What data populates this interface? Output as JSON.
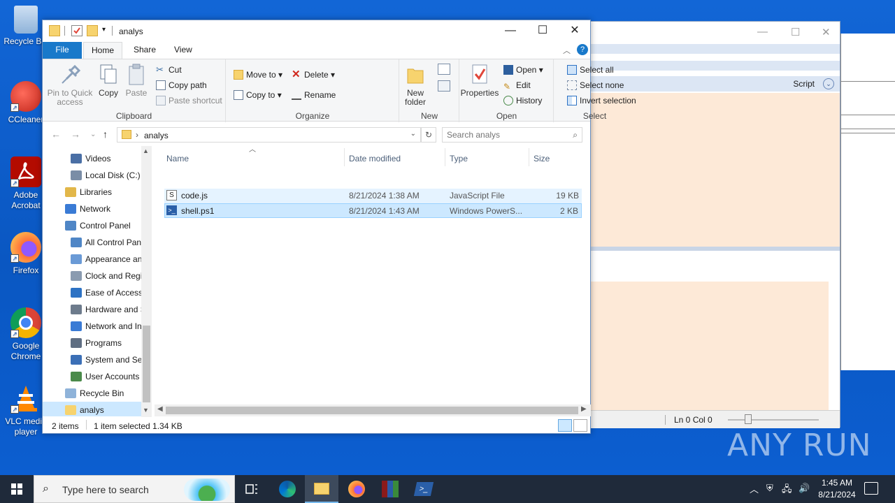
{
  "desktop": {
    "icons": [
      {
        "label": "Recycle Bin",
        "color": "#8fb3d9"
      },
      {
        "label": "CCleaner",
        "color": "#e23b2e"
      },
      {
        "label": "Adobe Acrobat",
        "color": "#b30b00"
      },
      {
        "label": "Firefox",
        "color": "#ff7139"
      },
      {
        "label": "Google Chrome",
        "color": "#4285f4"
      },
      {
        "label": "VLC media player",
        "color": "#ff8800"
      }
    ],
    "watermark": "ANY RUN"
  },
  "bg_window": {
    "script_label": "Script",
    "status_position": "Ln 0  Col 0"
  },
  "explorer": {
    "title": "analys",
    "ribbon_tabs": [
      "File",
      "Home",
      "Share",
      "View"
    ],
    "clipboard": {
      "pin_label": "Pin to Quick access",
      "copy_label": "Copy",
      "paste_label": "Paste",
      "cut_label": "Cut",
      "copy_path_label": "Copy path",
      "paste_shortcut_label": "Paste shortcut",
      "group_label": "Clipboard"
    },
    "organize": {
      "move_to_label": "Move to",
      "delete_label": "Delete",
      "copy_to_label": "Copy to",
      "rename_label": "Rename",
      "group_label": "Organize"
    },
    "new": {
      "new_folder_label": "New folder",
      "group_label": "New"
    },
    "open": {
      "properties_label": "Properties",
      "open_label": "Open",
      "edit_label": "Edit",
      "history_label": "History",
      "group_label": "Open"
    },
    "select": {
      "select_all_label": "Select all",
      "select_none_label": "Select none",
      "invert_label": "Invert selection",
      "group_label": "Select"
    },
    "address": {
      "crumb": "analys",
      "search_placeholder": "Search analys"
    },
    "nav_items": [
      {
        "label": "Videos",
        "indent": 1,
        "icon": "videos-icon",
        "color": "#4a6fa5"
      },
      {
        "label": "Local Disk (C:)",
        "indent": 1,
        "icon": "drive-icon",
        "color": "#7a8da6"
      },
      {
        "label": "Libraries",
        "indent": 0,
        "icon": "libraries-icon",
        "color": "#e2b74a"
      },
      {
        "label": "Network",
        "indent": 0,
        "icon": "network-icon",
        "color": "#3a7bd5"
      },
      {
        "label": "Control Panel",
        "indent": 0,
        "icon": "control-panel-icon",
        "color": "#4f86c6"
      },
      {
        "label": "All Control Panel Items",
        "indent": 1,
        "icon": "control-panel-icon",
        "color": "#4f86c6"
      },
      {
        "label": "Appearance and Personalization",
        "indent": 1,
        "icon": "appearance-icon",
        "color": "#6a9ad6"
      },
      {
        "label": "Clock and Region",
        "indent": 1,
        "icon": "clock-icon",
        "color": "#8a9bb0"
      },
      {
        "label": "Ease of Access",
        "indent": 1,
        "icon": "ease-of-access-icon",
        "color": "#2d72c4"
      },
      {
        "label": "Hardware and Sound",
        "indent": 1,
        "icon": "hardware-icon",
        "color": "#6d7b8c"
      },
      {
        "label": "Network and Internet",
        "indent": 1,
        "icon": "network-internet-icon",
        "color": "#3a7bd5"
      },
      {
        "label": "Programs",
        "indent": 1,
        "icon": "programs-icon",
        "color": "#5f6e82"
      },
      {
        "label": "System and Security",
        "indent": 1,
        "icon": "system-security-icon",
        "color": "#3b6fb6"
      },
      {
        "label": "User Accounts",
        "indent": 1,
        "icon": "user-accounts-icon",
        "color": "#4a8a4a"
      },
      {
        "label": "Recycle Bin",
        "indent": 0,
        "icon": "recycle-bin-icon",
        "color": "#8fb3d9"
      },
      {
        "label": "analys",
        "indent": 0,
        "icon": "folder-icon",
        "color": "#f7d36e",
        "selected": true
      }
    ],
    "columns": [
      "Name",
      "Date modified",
      "Type",
      "Size"
    ],
    "files": [
      {
        "name": "code.js",
        "date": "8/21/2024 1:38 AM",
        "type": "JavaScript File",
        "size": "19 KB",
        "state": "hover"
      },
      {
        "name": "shell.ps1",
        "date": "8/21/2024 1:43 AM",
        "type": "Windows PowerS...",
        "size": "2 KB",
        "state": "selected"
      }
    ],
    "status": {
      "items": "2 items",
      "selection": "1 item selected  1.34 KB"
    }
  },
  "taskbar": {
    "search_text": "Type here to search",
    "time": "1:45 AM",
    "date": "8/21/2024"
  }
}
